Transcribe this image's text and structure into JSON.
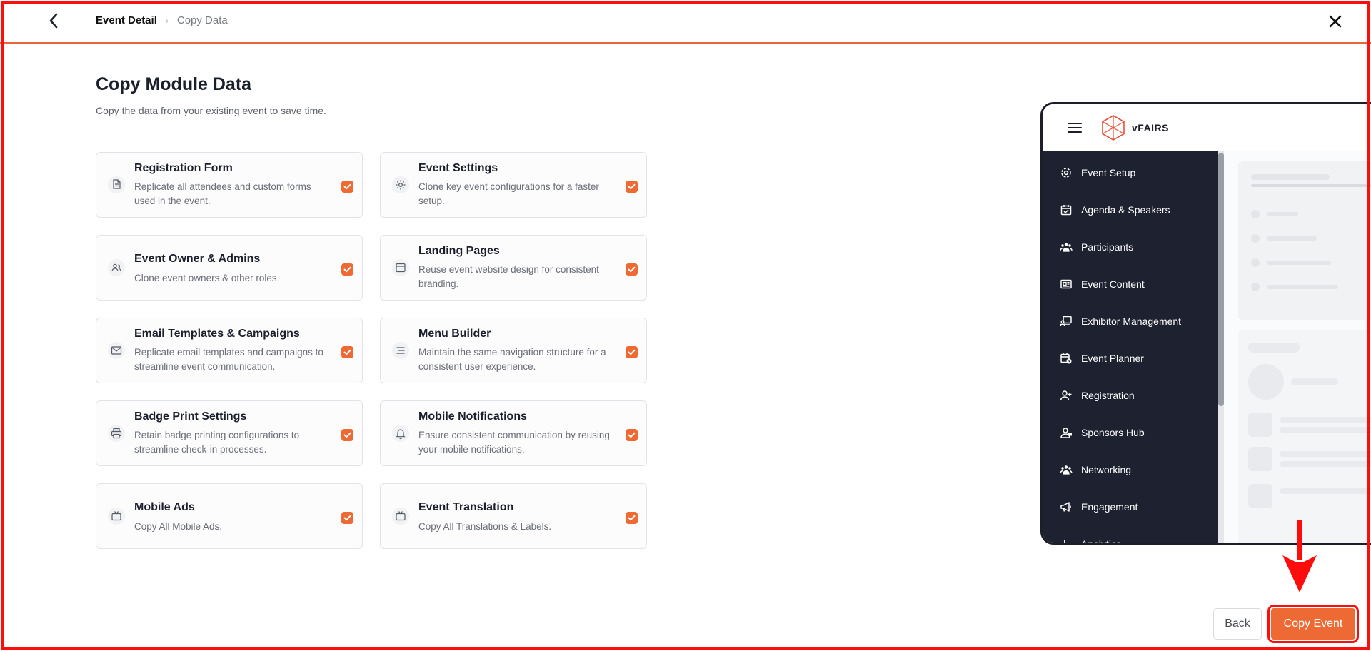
{
  "breadcrumb": {
    "current": "Event Detail",
    "separator": "›",
    "link": "Copy Data"
  },
  "header": {
    "title": "Copy Module Data",
    "subtitle": "Copy the data from your existing event to save time."
  },
  "modules": [
    {
      "title": "Registration Form",
      "desc": "Replicate all attendees and custom forms used in the event.",
      "icon": "document-icon",
      "checked": true
    },
    {
      "title": "Event Settings",
      "desc": "Clone key event configurations for a faster setup.",
      "icon": "gear-icon",
      "checked": true
    },
    {
      "title": "Event Owner & Admins",
      "desc": "Clone event owners & other roles.",
      "icon": "users-icon",
      "checked": true
    },
    {
      "title": "Landing Pages",
      "desc": "Reuse event website design for consistent branding.",
      "icon": "browser-window-icon",
      "checked": true
    },
    {
      "title": "Email Templates & Campaigns",
      "desc": "Replicate email templates and campaigns to streamline event communication.",
      "icon": "envelope-icon",
      "checked": true
    },
    {
      "title": "Menu Builder",
      "desc": "Maintain the same navigation structure for a consistent user experience.",
      "icon": "menu-lines-icon",
      "checked": true
    },
    {
      "title": "Badge Print Settings",
      "desc": "Retain badge printing configurations to streamline check-in processes.",
      "icon": "printer-icon",
      "checked": true
    },
    {
      "title": "Mobile Notifications",
      "desc": "Ensure consistent communication by reusing your mobile notifications.",
      "icon": "bell-icon",
      "checked": true
    },
    {
      "title": "Mobile Ads",
      "desc": "Copy All Mobile Ads.",
      "icon": "tv-icon",
      "checked": true
    },
    {
      "title": "Event Translation",
      "desc": "Copy All Translations & Labels.",
      "icon": "tv-icon",
      "checked": true
    }
  ],
  "preview": {
    "logo_text": "vFAIRS",
    "menu": [
      {
        "label": "Event Setup",
        "icon": "gear-icon"
      },
      {
        "label": "Agenda & Speakers",
        "icon": "calendar-check-icon"
      },
      {
        "label": "Participants",
        "icon": "people-group-icon"
      },
      {
        "label": "Event Content",
        "icon": "newspaper-icon"
      },
      {
        "label": "Exhibitor Management",
        "icon": "booth-icon"
      },
      {
        "label": "Event Planner",
        "icon": "calendar-clock-icon"
      },
      {
        "label": "Registration",
        "icon": "user-plus-icon"
      },
      {
        "label": "Sponsors Hub",
        "icon": "user-badge-icon"
      },
      {
        "label": "Networking",
        "icon": "people-group-icon"
      },
      {
        "label": "Engagement",
        "icon": "megaphone-icon"
      },
      {
        "label": "Analytics",
        "icon": "bar-chart-icon"
      }
    ]
  },
  "footer": {
    "back_label": "Back",
    "copy_label": "Copy Event"
  },
  "colors": {
    "accent": "#ee6a35",
    "annotation": "#ff0d0d",
    "sidebar": "#1e2130"
  }
}
